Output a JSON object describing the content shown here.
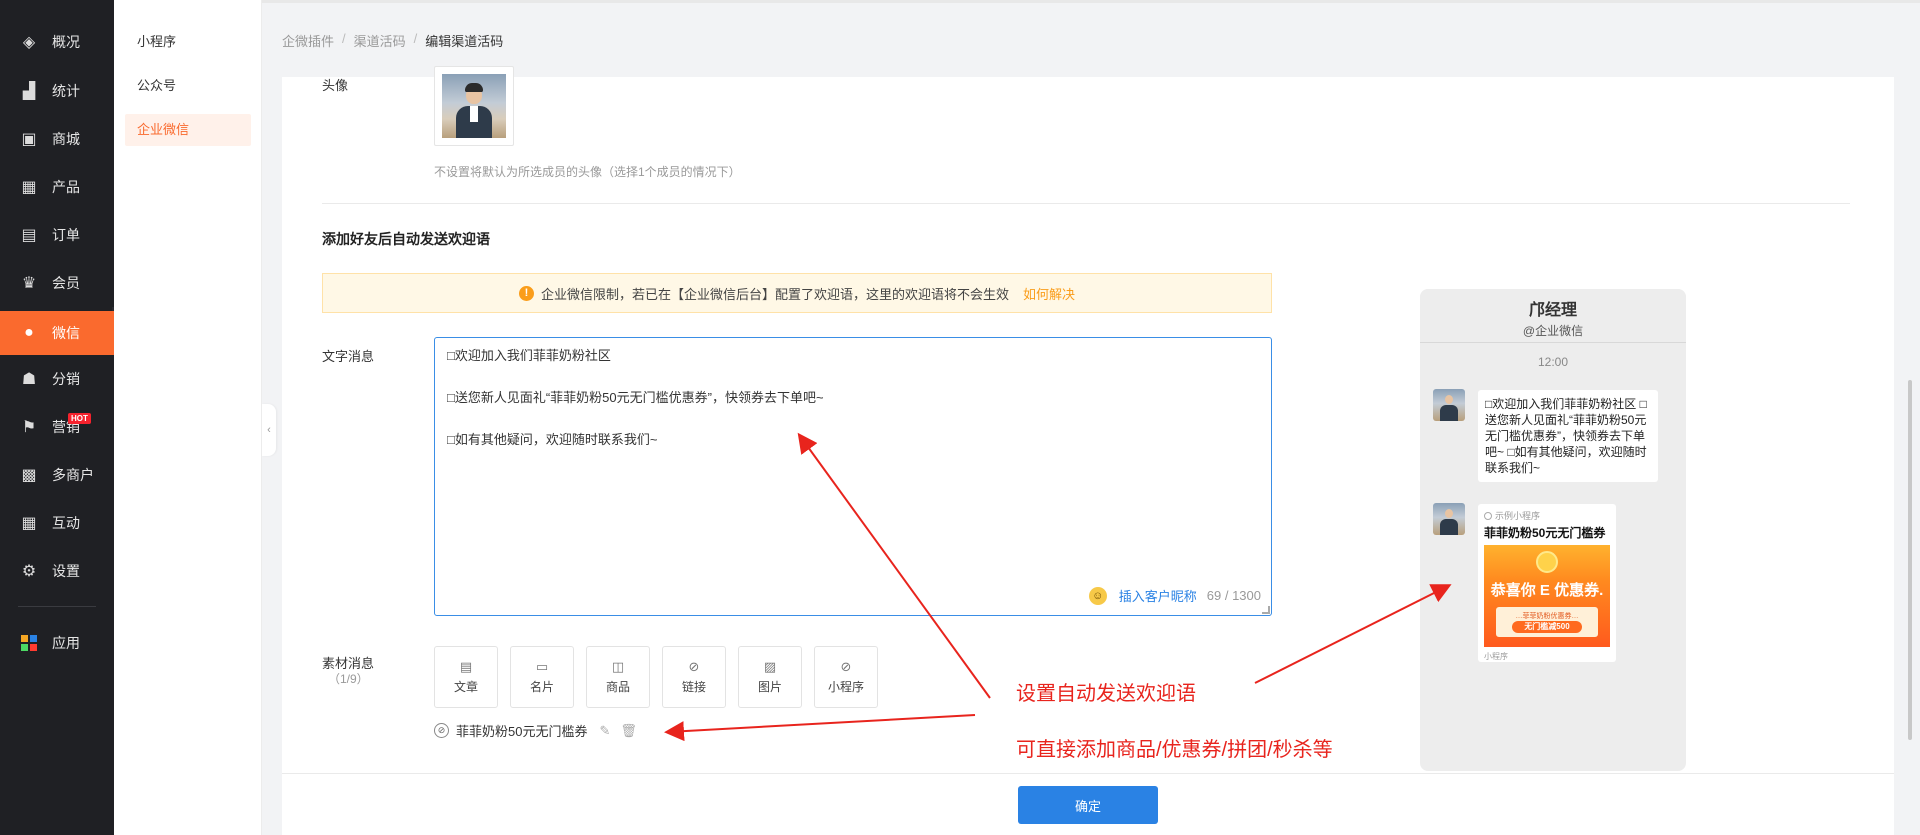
{
  "sidebar": {
    "items": [
      {
        "label": "概况",
        "icon": "layers-icon",
        "glyph": "◈"
      },
      {
        "label": "统计",
        "icon": "chart-icon",
        "glyph": "▟"
      },
      {
        "label": "商城",
        "icon": "store-icon",
        "glyph": "▣"
      },
      {
        "label": "产品",
        "icon": "product-grid-icon",
        "glyph": "▦"
      },
      {
        "label": "订单",
        "icon": "order-icon",
        "glyph": "▤"
      },
      {
        "label": "会员",
        "icon": "crown-icon",
        "glyph": "♛"
      },
      {
        "label": "微信",
        "icon": "wechat-icon",
        "glyph": "●"
      },
      {
        "label": "分销",
        "icon": "users-icon",
        "glyph": "☗"
      },
      {
        "label": "营销",
        "icon": "flag-icon",
        "glyph": "⚑",
        "badge": "HOT"
      },
      {
        "label": "多商户",
        "icon": "multi-store-icon",
        "glyph": "▩"
      },
      {
        "label": "互动",
        "icon": "interaction-icon",
        "glyph": "▦"
      },
      {
        "label": "设置",
        "icon": "gear-icon",
        "glyph": "⚙"
      },
      {
        "label": "应用",
        "icon": "apps-icon",
        "glyph": "▪"
      }
    ]
  },
  "subnav": {
    "items": [
      {
        "label": "小程序"
      },
      {
        "label": "公众号"
      },
      {
        "label": "企业微信"
      }
    ]
  },
  "breadcrumb": {
    "items": [
      "企微插件",
      "渠道活码",
      "编辑渠道活码"
    ],
    "separator": "/"
  },
  "form": {
    "avatar_label": "头像",
    "avatar_hint": "不设置将默认为所选成员的头像（选择1个成员的情况下）",
    "welcome_title": "添加好友后自动发送欢迎语",
    "warning_text": "企业微信限制，若已在【企业微信后台】配置了欢迎语，这里的欢迎语将不会生效",
    "warning_link": "如何解决",
    "text_label": "文字消息",
    "message_lines": [
      "□欢迎加入我们菲菲奶粉社区",
      "□送您新人见面礼“菲菲奶粉50元无门槛优惠券”，快领券去下单吧~",
      "□如有其他疑问，欢迎随时联系我们~"
    ],
    "insert_nickname": "插入客户昵称",
    "counter": "69 / 1300",
    "material_label": "素材消息",
    "material_count": "（1/9）",
    "material_buttons": [
      {
        "label": "文章",
        "icon": "article-icon",
        "glyph": "▤"
      },
      {
        "label": "名片",
        "icon": "card-icon",
        "glyph": "▭"
      },
      {
        "label": "商品",
        "icon": "bag-icon",
        "glyph": "◫"
      },
      {
        "label": "链接",
        "icon": "link-icon",
        "glyph": "⊘"
      },
      {
        "label": "图片",
        "icon": "image-icon",
        "glyph": "▨"
      },
      {
        "label": "小程序",
        "icon": "miniprogram-icon",
        "glyph": "⊘"
      }
    ],
    "attached_item": "菲菲奶粉50元无门槛券",
    "confirm_label": "确定"
  },
  "preview": {
    "name": "邝经理",
    "sub": "@企业微信",
    "time": "12:00",
    "bubble_text": "□欢迎加入我们菲菲奶粉社区 □送您新人见面礼“菲菲奶粉50元无门槛优惠券”，快领券去下单吧~ □如有其他疑问，欢迎随时联系我们~",
    "mp_source": "示例小程序",
    "mp_title": "菲菲奶粉50元无门槛券",
    "mp_banner": "恭喜你 E 优惠券.",
    "mp_coupon_top": "…菲菲奶粉优惠券…",
    "mp_coupon_btn": "无门槛减500",
    "mp_footer": "小程序"
  },
  "annotations": {
    "line1": "设置自动发送欢迎语",
    "line2": "可直接添加商品/优惠券/拼团/秒杀等",
    "color": "#e8241d"
  },
  "colors": {
    "accent": "#fa6a2e",
    "primary": "#2a82e4",
    "sidebar_bg": "#1f2024"
  }
}
